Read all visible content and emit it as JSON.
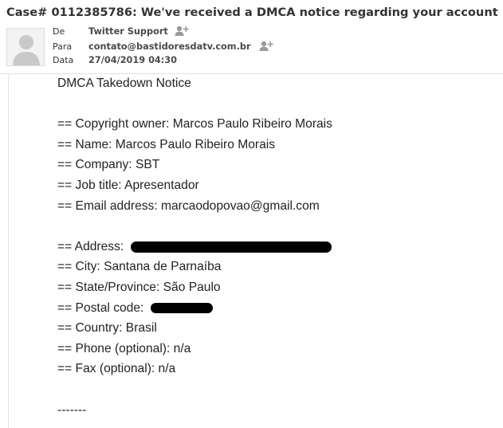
{
  "email": {
    "subject": "Case# 0112385786: We've received a DMCA notice regarding your account",
    "from_label": "De",
    "from_value": "Twitter Support",
    "to_label": "Para",
    "to_value": "contato@bastidoresdatv.com.br",
    "date_label": "Data",
    "date_value": "27/04/2019 04:30"
  },
  "body": {
    "title": "DMCA Takedown Notice",
    "copyright_owner": "== Copyright owner: Marcos Paulo Ribeiro Morais",
    "name": "== Name: Marcos Paulo Ribeiro Morais",
    "company": "== Company: SBT",
    "job_title": "== Job title: Apresentador",
    "email_address": "== Email address: marcaodopovao@gmail.com",
    "address_label": "== Address:",
    "city": "== City: Santana de Parnaíba",
    "state": "== State/Province: São Paulo",
    "postal_label": "== Postal code:",
    "country": "== Country: Brasil",
    "phone": "== Phone (optional): n/a",
    "fax": "== Fax (optional): n/a",
    "separator": "-------"
  },
  "icons": {
    "avatar": "default-user-avatar",
    "add_contact": "add-contact-icon"
  }
}
